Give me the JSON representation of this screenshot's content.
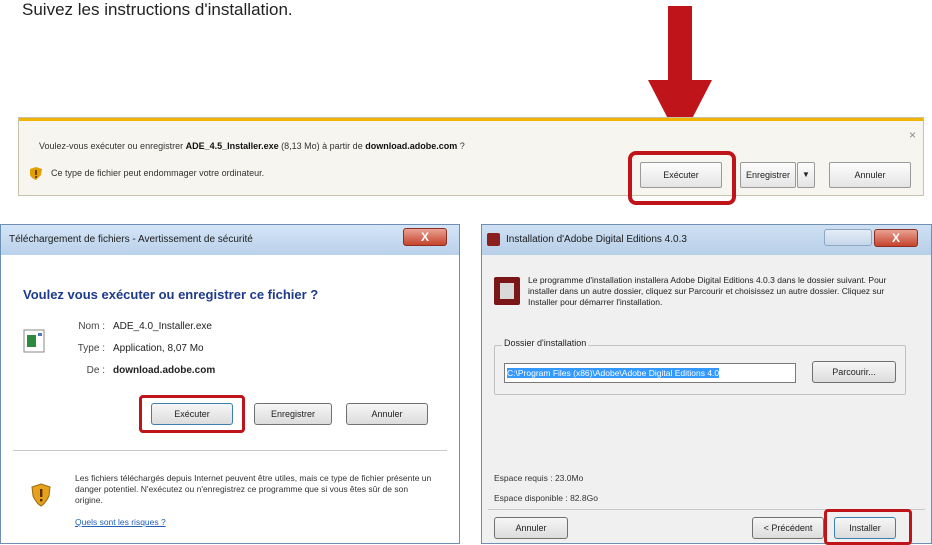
{
  "instruction": "Suivez les instructions d'installation.",
  "colors": {
    "highlight": "#c0141b",
    "arrow": "#c0141b",
    "notif_accent": "#f0b400"
  },
  "notification_bar": {
    "question_prefix": "Voulez-vous exécuter ou enregistrer ",
    "file_name": "ADE_4.5_Installer.exe",
    "size": " (8,13 Mo) à partir de ",
    "source": "download.adobe.com",
    "question_suffix": " ?",
    "warning": "Ce type de fichier peut endommager votre ordinateur.",
    "close": "×",
    "buttons": {
      "run": "Exécuter",
      "save": "Enregistrer",
      "save_dropdown": "▼",
      "cancel": "Annuler"
    }
  },
  "download_dialog": {
    "title": "Téléchargement de fichiers - Avertissement de sécurité",
    "close": "X",
    "question": "Voulez vous exécuter ou enregistrer ce fichier ?",
    "name_label": "Nom :",
    "name_value": "ADE_4.0_Installer.exe",
    "type_label": "Type :",
    "type_value": "Application, 8,07 Mo",
    "from_label": "De :",
    "from_value": "download.adobe.com",
    "buttons": {
      "run": "Exécuter",
      "save": "Enregistrer",
      "cancel": "Annuler"
    },
    "security_text": "Les fichiers téléchargés depuis Internet peuvent être utiles, mais ce type de fichier présente un danger potentiel. N'exécutez ou n'enregistrez ce programme que si vous êtes sûr de son origine.",
    "risk_link": "Quels sont les risques ?"
  },
  "installer_dialog": {
    "title": "Installation d'Adobe Digital Editions 4.0.3",
    "close": "X",
    "description": "Le programme d'installation installera Adobe Digital Editions 4.0.3 dans le dossier suivant. Pour installer dans un autre dossier, cliquez sur Parcourir et choisissez un autre dossier. Cliquez sur Installer pour démarrer l'installation.",
    "folder_group_label": "Dossier d'installation",
    "folder_path": "C:\\Program Files (x86)\\Adobe\\Adobe Digital Editions 4.0",
    "browse_button": "Parcourir...",
    "space_required": "Espace requis : 23.0Mo",
    "space_available": "Espace disponible : 82.8Go",
    "buttons": {
      "cancel": "Annuler",
      "previous": "< Précédent",
      "install": "Installer"
    }
  }
}
